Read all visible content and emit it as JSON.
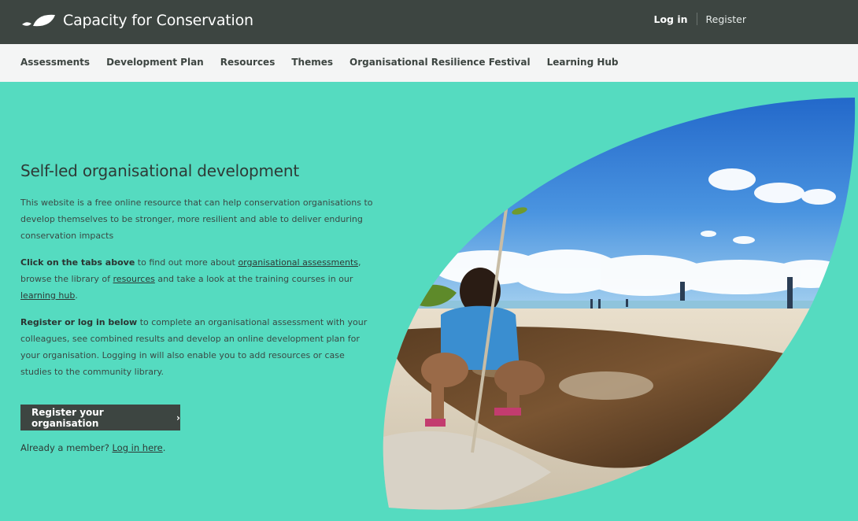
{
  "header": {
    "brand": "Capacity for Conservation",
    "login": "Log in",
    "register": "Register"
  },
  "nav": {
    "items": [
      "Assessments",
      "Development Plan",
      "Resources",
      "Themes",
      "Organisational Resilience Festival",
      "Learning Hub"
    ]
  },
  "hero": {
    "headline": "Self-led organisational development",
    "intro": "This website is a free online resource that can help conservation organisations to develop themselves to be stronger, more resilient and able to deliver enduring conservation impacts",
    "p2_bold": "Click on the tabs above",
    "p2_a": " to find out more about ",
    "p2_link1": "organisational assessments",
    "p2_b": ", browse the library of ",
    "p2_link2": "resources",
    "p2_c": " and take a look at the training courses in our ",
    "p2_link3": "learning hub",
    "p2_d": ".",
    "p3_bold": "Register or log in below",
    "p3_rest": " to complete an organisational assessment with your colleagues, see combined results and develop an online development plan for your organisation. Logging in will also enable you to add resources or case studies to the community library.",
    "cta_label": "Register your organisation",
    "cta_chevron": "›",
    "member_text": "Already a member? ",
    "member_link": "Log in here",
    "member_end": "."
  },
  "colors": {
    "topbar": "#3d4541",
    "navbar": "#f4f5f5",
    "hero_bg": "#55dbc0",
    "button": "#3d4541"
  },
  "icons": {
    "logo": "leaf-logo-icon",
    "cta": "chevron-right-icon"
  }
}
